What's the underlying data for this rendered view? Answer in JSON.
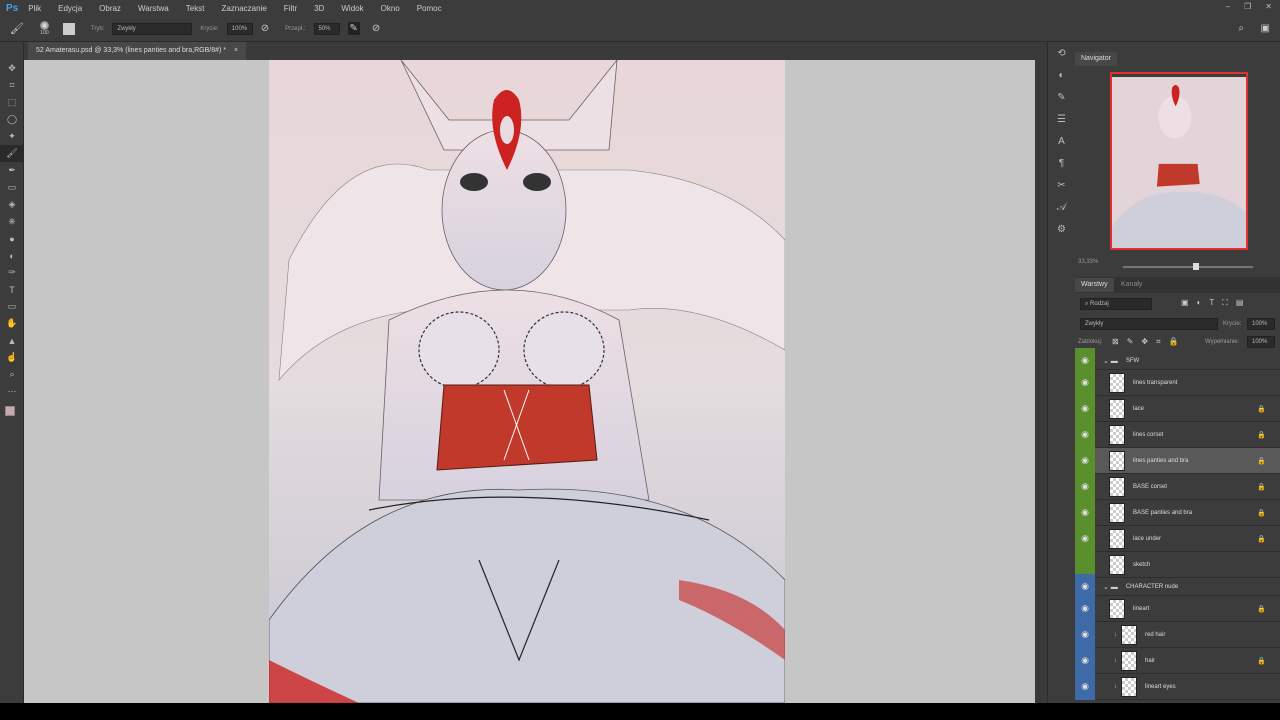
{
  "app": {
    "logo": "Ps",
    "menu": [
      "Plik",
      "Edycja",
      "Obraz",
      "Warstwa",
      "Tekst",
      "Zaznaczanie",
      "Filtr",
      "3D",
      "Widok",
      "Okno",
      "Pomoc"
    ]
  },
  "options": {
    "brush_size": "100",
    "mode_label": "Tryb:",
    "mode_value": "Zwykły",
    "opacity_label": "Krycie:",
    "opacity_value": "100%",
    "flow_label": "Przepł.:",
    "flow_value": "50%"
  },
  "document_tab": {
    "title": "52  Amaterasu.psd @ 33,3% (lines panties and bra,RGB/8#) *",
    "close": "×"
  },
  "navigator": {
    "title": "Navigator",
    "zoom": "33,33%"
  },
  "layers_panel": {
    "tabs": [
      "Warstwy",
      "Kanały"
    ],
    "filter_label": "Rodzaj",
    "blend_mode": "Zwykły",
    "opacity_label": "Krycie:",
    "opacity_value": "100%",
    "lock_label": "Zablokuj:",
    "fill_label": "Wypełnianie:",
    "fill_value": "100%",
    "layers": [
      {
        "name": "SFW",
        "type": "group",
        "color": "#5a8f2e",
        "visible": true
      },
      {
        "name": "lines transparent",
        "color": "#5a8f2e",
        "visible": true,
        "locked": false
      },
      {
        "name": "lace",
        "color": "#5a8f2e",
        "visible": true,
        "locked": true
      },
      {
        "name": "lines corset",
        "color": "#5a8f2e",
        "visible": true,
        "locked": true
      },
      {
        "name": "lines panties and bra",
        "color": "#5a8f2e",
        "visible": true,
        "locked": true,
        "selected": true
      },
      {
        "name": "BASE corset",
        "color": "#5a8f2e",
        "visible": true,
        "locked": true
      },
      {
        "name": "BASE panties and bra",
        "color": "#5a8f2e",
        "visible": true,
        "locked": true
      },
      {
        "name": "lace under",
        "color": "#5a8f2e",
        "visible": true,
        "locked": true
      },
      {
        "name": "sketch",
        "color": "#5a8f2e",
        "visible": false,
        "locked": false
      },
      {
        "name": "CHARACTER nude",
        "type": "group",
        "color": "#3f6aa8",
        "visible": true
      },
      {
        "name": "lineart",
        "color": "#3f6aa8",
        "visible": true,
        "locked": true
      },
      {
        "name": "red hair",
        "color": "#3f6aa8",
        "visible": true,
        "locked": false,
        "clipped": true
      },
      {
        "name": "hair",
        "color": "#3f6aa8",
        "visible": true,
        "locked": true,
        "clipped": true
      },
      {
        "name": "lineart eyes",
        "color": "#3f6aa8",
        "visible": true,
        "locked": false,
        "clipped": true
      }
    ]
  },
  "colors": {
    "accent_red": "#c0392b",
    "panel": "#3c3c3c",
    "canvas_bg": "#c6c6c6"
  }
}
